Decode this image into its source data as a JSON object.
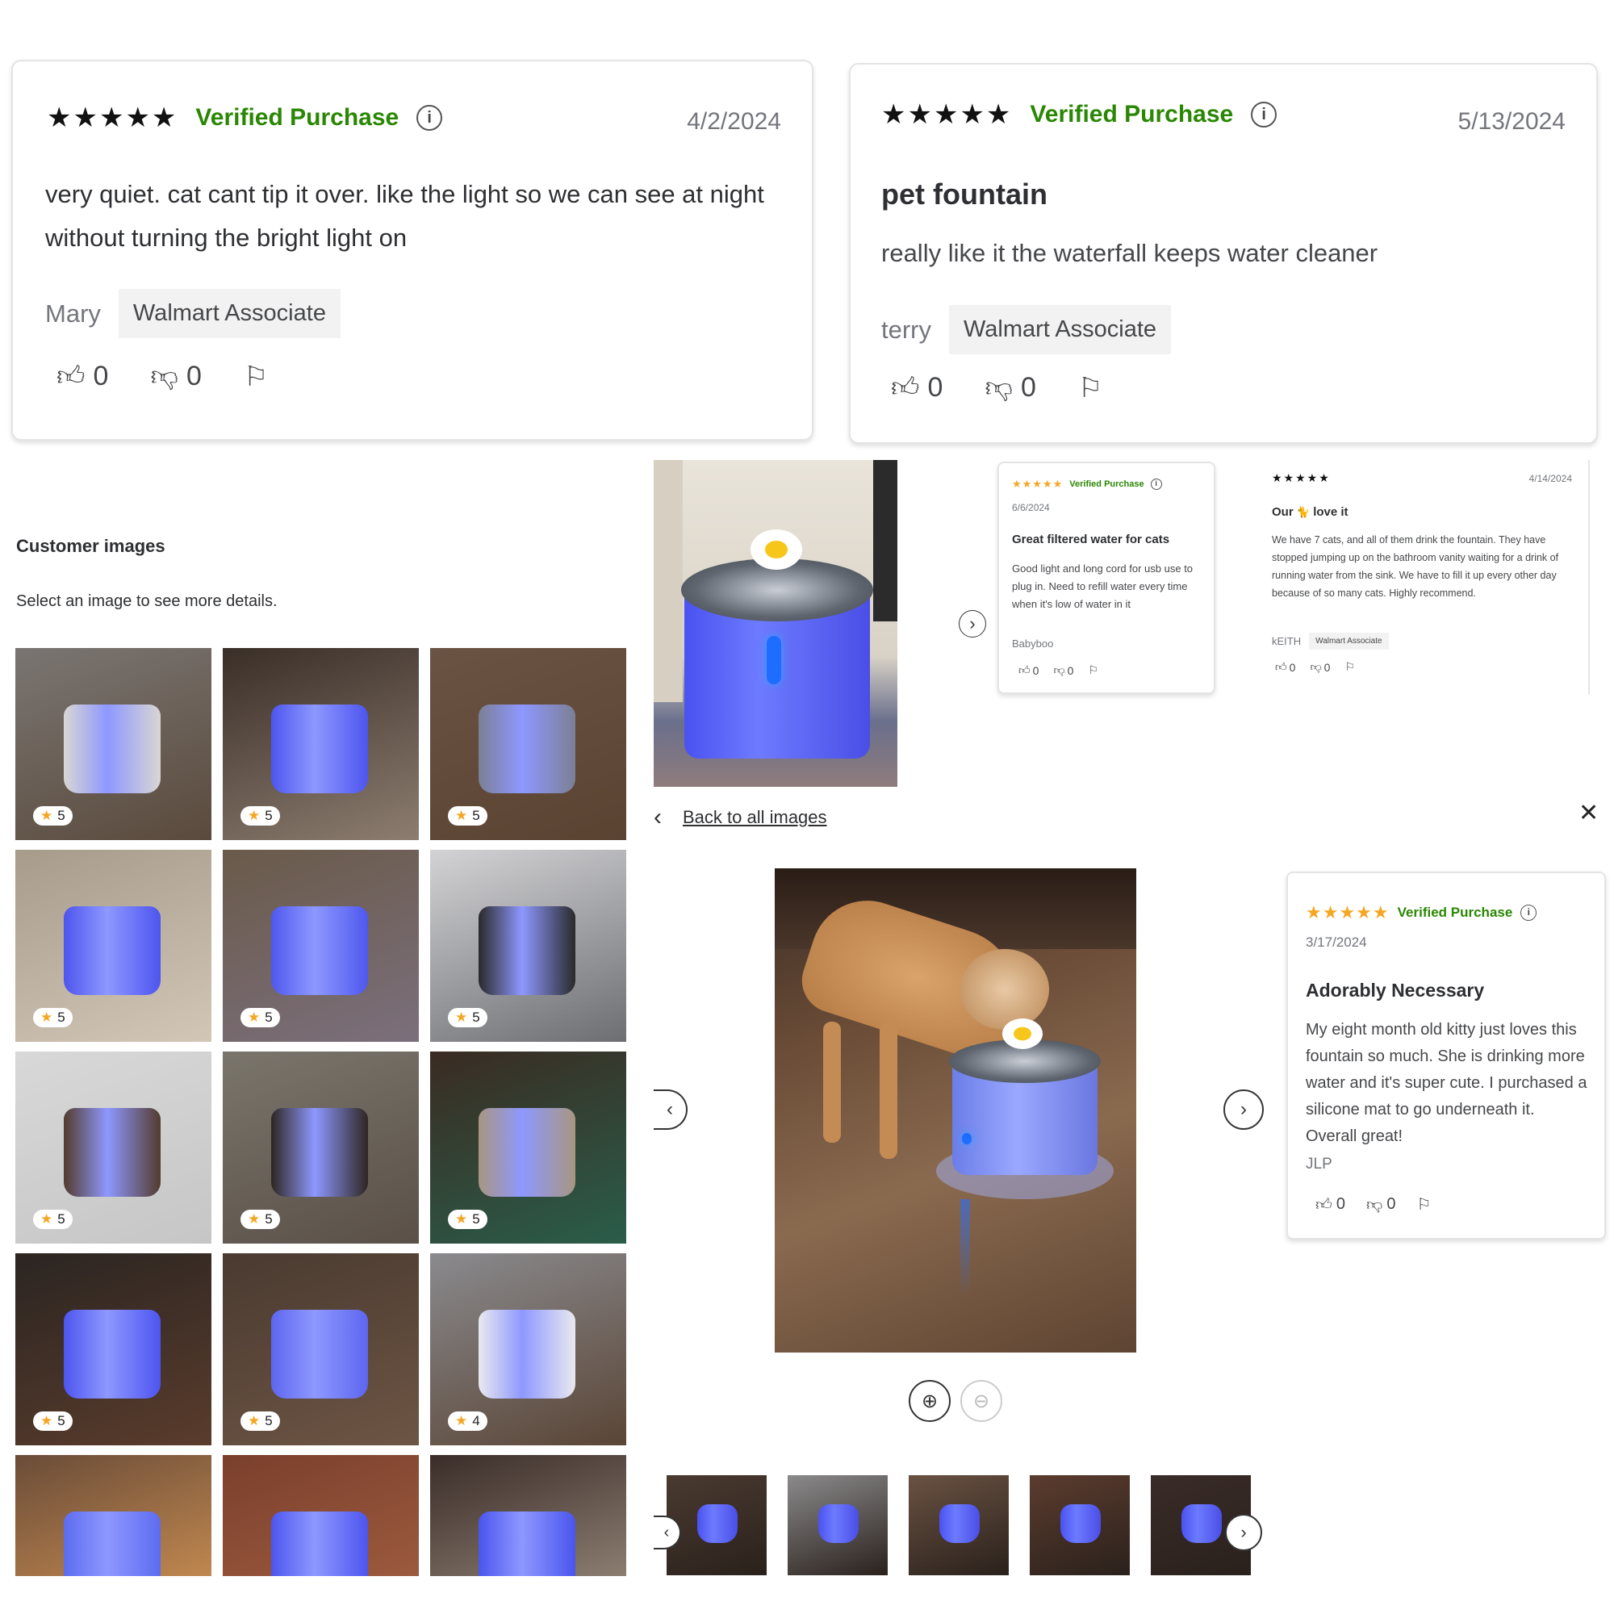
{
  "review1": {
    "stars": "★★★★★",
    "verified": "Verified Purchase",
    "info": "i",
    "date": "4/2/2024",
    "text": "very quiet. cat cant tip it over. like the light so we can see at night without turning the bright light on",
    "author": "Mary",
    "tag": "Walmart Associate",
    "up": "0",
    "down": "0"
  },
  "review2": {
    "stars": "★★★★★",
    "verified": "Verified Purchase",
    "info": "i",
    "date": "5/13/2024",
    "title": "pet fountain",
    "text": "really like it the waterfall keeps water cleaner",
    "author": "terry",
    "tag": "Walmart Associate",
    "up": "0",
    "down": "0"
  },
  "customer_images": {
    "heading": "Customer images",
    "subtitle": "Select an image to see more details.",
    "tiles": [
      {
        "rating": "5",
        "scene": "cat-drinking-top-view"
      },
      {
        "rating": "5",
        "scene": "blue-fountain-closeup"
      },
      {
        "rating": "5",
        "scene": "fountain-on-mat"
      },
      {
        "rating": "5",
        "scene": "fountain-countertop"
      },
      {
        "rating": "5",
        "scene": "fountain-on-rug"
      },
      {
        "rating": "5",
        "scene": "black-cat"
      },
      {
        "rating": "5",
        "scene": "fountain-on-brown-mat"
      },
      {
        "rating": "5",
        "scene": "tortoiseshell-cat"
      },
      {
        "rating": "5",
        "scene": "two-cats-floor"
      },
      {
        "rating": "5",
        "scene": "cats-with-fountain"
      },
      {
        "rating": "5",
        "scene": "fountain-tile-floor"
      },
      {
        "rating": "4",
        "scene": "fountain-paw-mat"
      },
      {
        "rating": "",
        "scene": "orange-cat-drinking"
      },
      {
        "rating": "",
        "scene": "fountain-red-tiles"
      },
      {
        "rating": "",
        "scene": "fountain-blue-closeup"
      }
    ]
  },
  "small_review1": {
    "stars": "★★★★★",
    "verified": "Verified Purchase",
    "info": "i",
    "date": "6/6/2024",
    "title": "Great filtered water for cats",
    "text": "Good light and long cord for usb use to plug in. Need to refill water every time when it's low of water in it",
    "author": "Babyboo",
    "up": "0",
    "down": "0"
  },
  "small_review2": {
    "stars": "★★★★★",
    "date": "4/14/2024",
    "title_prefix": "Our",
    "title_suffix": "love it",
    "emoji": "🐈",
    "text": "We have 7 cats, and all of them drink the fountain. They have stopped jumping up on the bathroom vanity waiting for a drink of running water from the sink. We have to fill it up every other day because of so many cats. Highly recommend.",
    "author": "kEITH",
    "tag": "Walmart Associate",
    "up": "0",
    "down": "0"
  },
  "viewer": {
    "back_label": "Back to all images",
    "close": "✕",
    "prev": "‹",
    "next": "›",
    "zoom_in": "⊕",
    "zoom_out": "⊖",
    "thumbnails": [
      "thumb-1",
      "thumb-2",
      "thumb-3",
      "thumb-4",
      "thumb-5"
    ]
  },
  "detail_review": {
    "stars": "★★★★★",
    "verified": "Verified Purchase",
    "info": "i",
    "date": "3/17/2024",
    "title": "Adorably Necessary",
    "text": "My eight month old kitty just loves this fountain so much. She is drinking more water and it's super cute. I purchased a silicone mat to go underneath it. Overall great!",
    "author": "JLP",
    "up": "0",
    "down": "0"
  },
  "colors": {
    "verified_green": "#2a8703",
    "star_yellow": "#f5a623",
    "fountain_blue": "#4a52f0"
  }
}
